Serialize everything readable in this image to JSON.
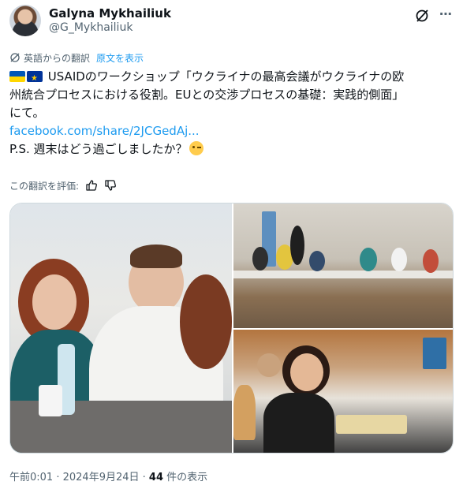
{
  "author": {
    "name": "Galyna Mykhailiuk",
    "handle": "@G_Mykhailiuk"
  },
  "translation": {
    "label": "英語からの翻訳",
    "show_original": "原文を表示"
  },
  "tweet": {
    "line1": "USAIDのワークショップ「ウクライナの最高会議がウクライナの欧",
    "line2": "州統合プロセスにおける役割。EUとの交渉プロセスの基礎：実践的側面」",
    "line3": "にて。",
    "link": "facebook.com/share/2JCGedAj...",
    "ps": "P.S. 週末はどう過ごしましたか？"
  },
  "rate": {
    "label": "この翻訳を評価:"
  },
  "footer": {
    "time": "午前0:01",
    "sep1": " · ",
    "date": "2024年9月24日",
    "sep2": " · ",
    "views_count": "44",
    "views_label": " 件の表示"
  },
  "icons": [
    "grok-icon",
    "more-icon",
    "translate-icon",
    "thumbs-up-icon",
    "thumbs-down-icon",
    "ukraine-flag-icon",
    "eu-flag-icon",
    "wink-emoji-icon"
  ],
  "colors": {
    "accent": "#1d9bf0",
    "secondary": "#536471",
    "text": "#0f1419"
  }
}
